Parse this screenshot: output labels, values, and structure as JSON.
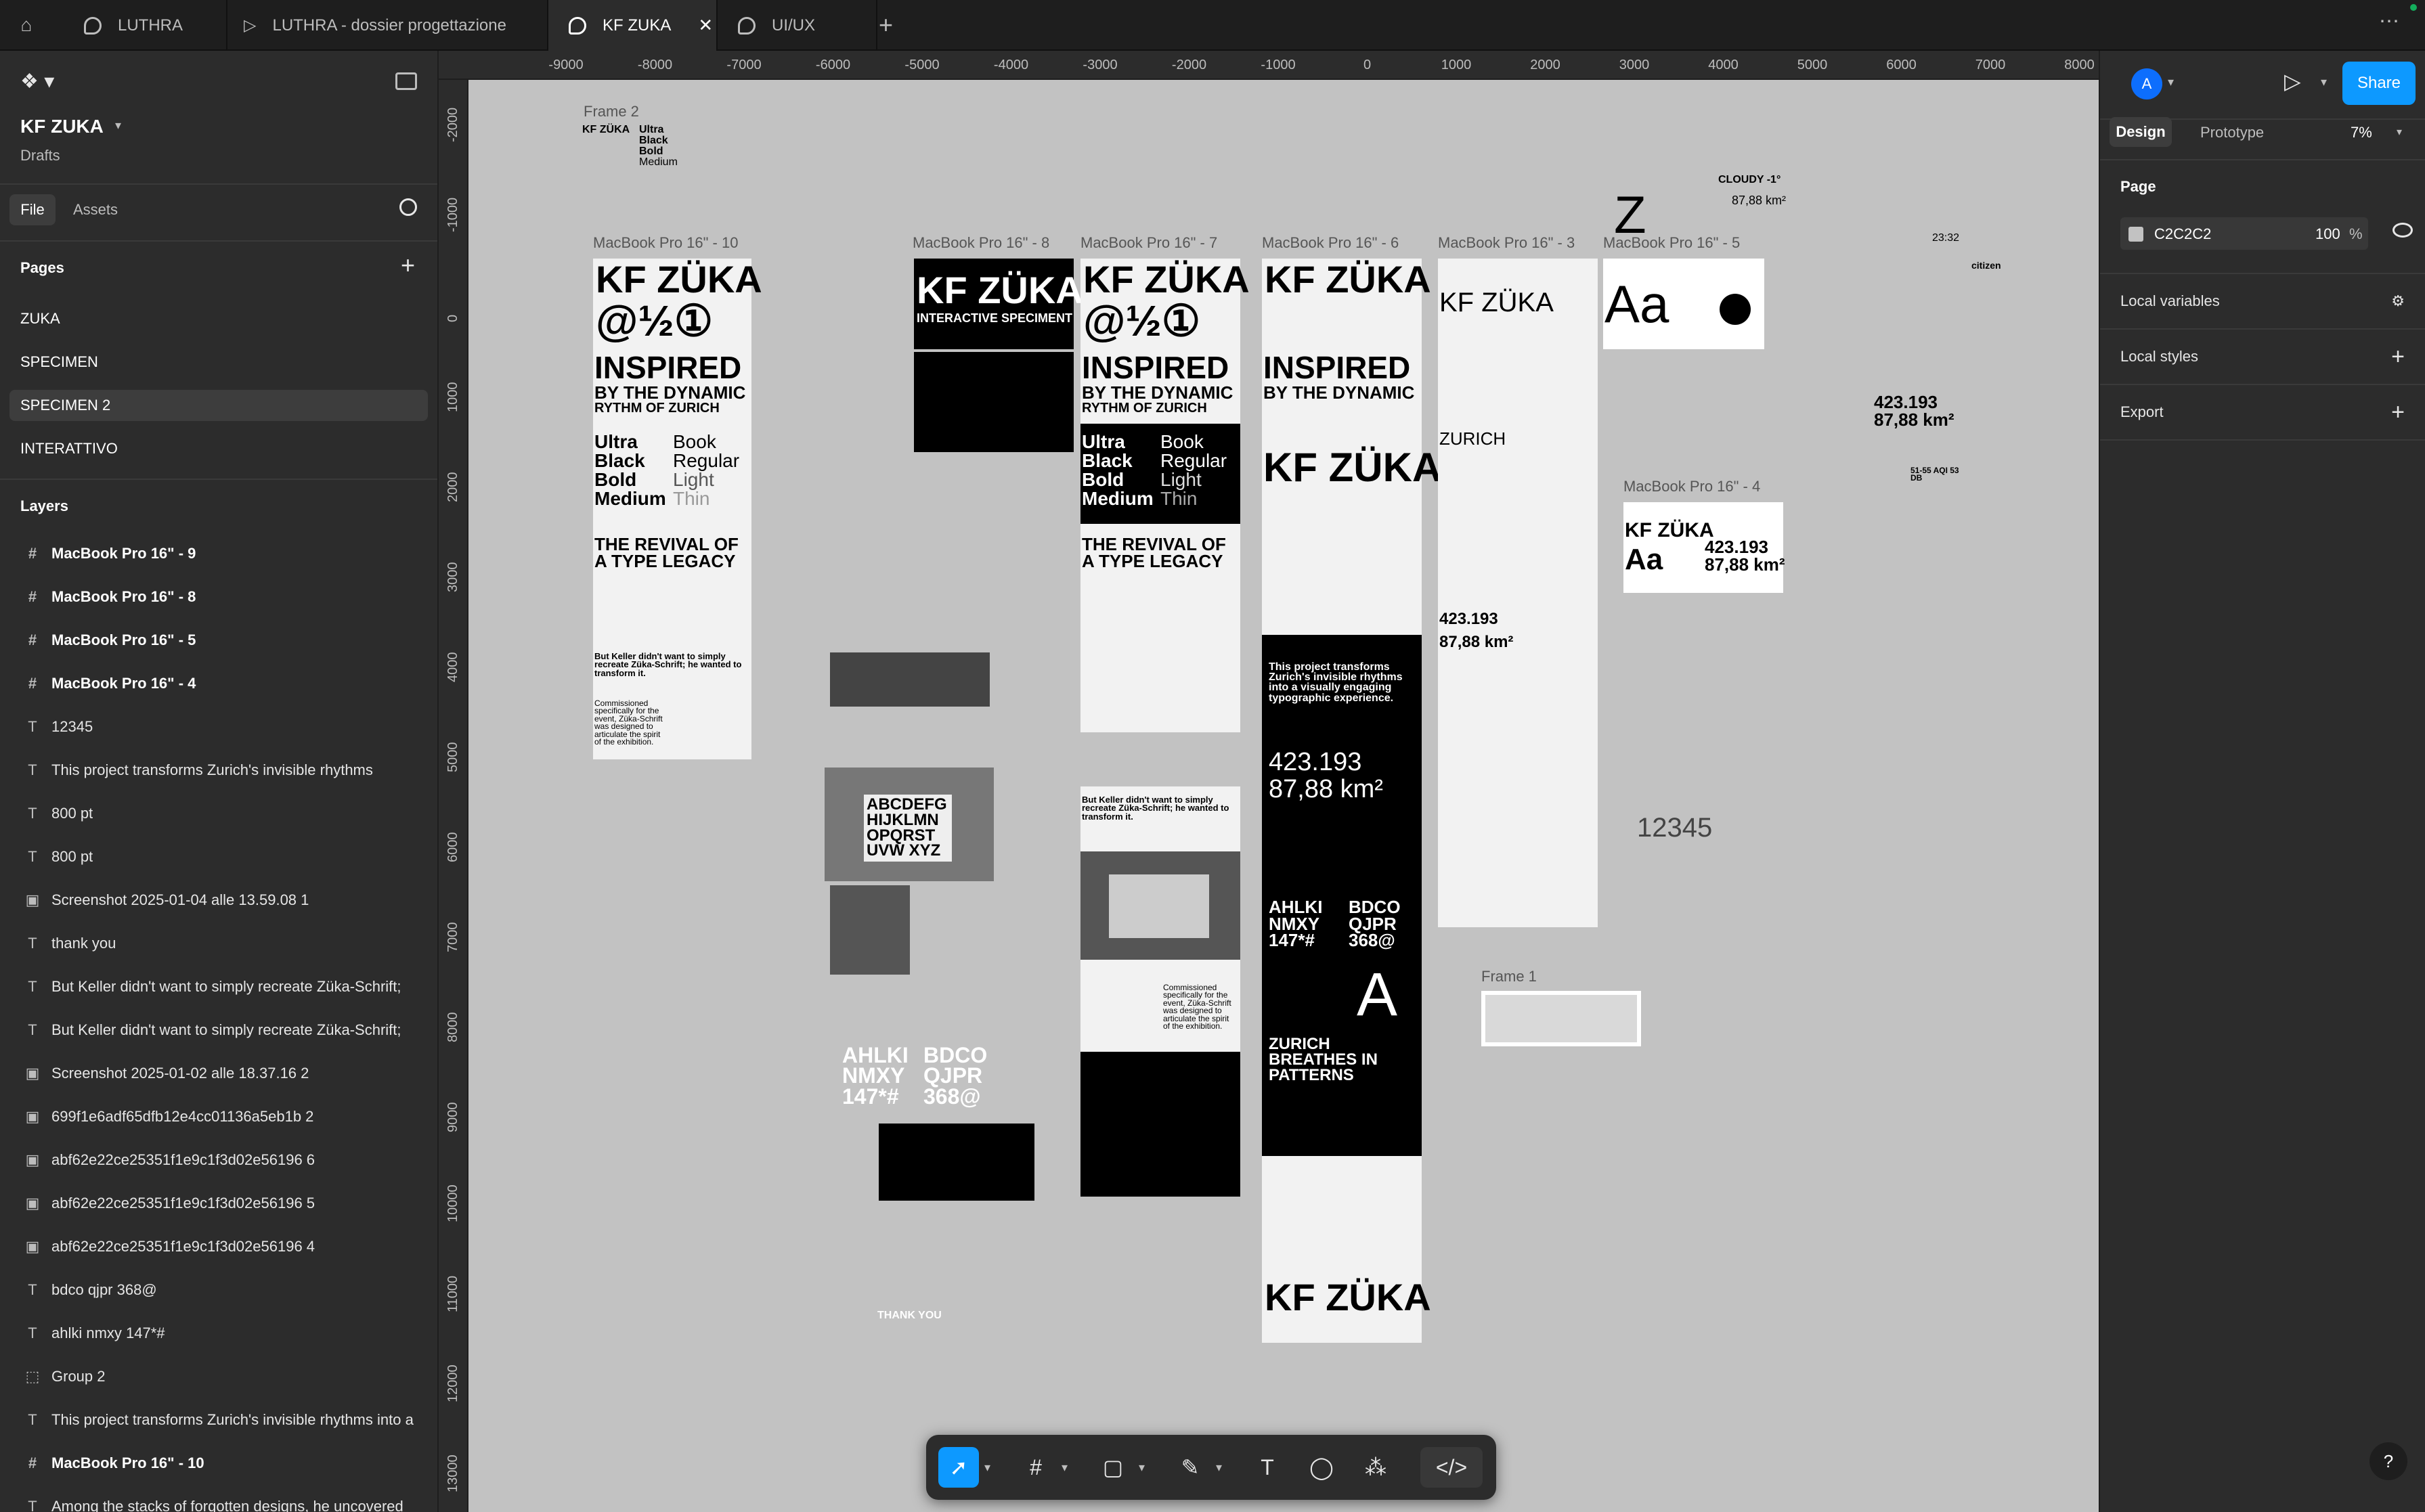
{
  "tabs": [
    {
      "label": "LUTHRA",
      "icon": "figma-file-icon"
    },
    {
      "label": "LUTHRA - dossier progettazione",
      "icon": "slides-icon"
    },
    {
      "label": "KF ZUKA",
      "icon": "figma-file-icon",
      "active": true
    },
    {
      "label": "UI/UX",
      "icon": "figma-file-icon"
    }
  ],
  "file": {
    "name": "KF ZUKA",
    "location": "Drafts"
  },
  "left_tabs": {
    "file": "File",
    "assets": "Assets"
  },
  "pages": {
    "heading": "Pages",
    "items": [
      "ZUKA",
      "SPECIMEN",
      "SPECIMEN 2",
      "INTERATTIVO"
    ],
    "selected": "SPECIMEN 2"
  },
  "layers": {
    "heading": "Layers",
    "items": [
      {
        "icon": "#",
        "name": "MacBook Pro 16\" - 9",
        "bold": true
      },
      {
        "icon": "#",
        "name": "MacBook Pro 16\" - 8",
        "bold": true
      },
      {
        "icon": "#",
        "name": "MacBook Pro 16\" - 5",
        "bold": true
      },
      {
        "icon": "#",
        "name": "MacBook Pro 16\" - 4",
        "bold": true
      },
      {
        "icon": "T",
        "name": "12345"
      },
      {
        "icon": "T",
        "name": "This project transforms Zurich's invisible rhythms"
      },
      {
        "icon": "T",
        "name": "800 pt"
      },
      {
        "icon": "T",
        "name": "800 pt"
      },
      {
        "icon": "▣",
        "name": "Screenshot 2025-01-04 alle 13.59.08 1"
      },
      {
        "icon": "T",
        "name": "thank you"
      },
      {
        "icon": "T",
        "name": "But Keller didn't want to simply recreate Züka-Schrift;"
      },
      {
        "icon": "T",
        "name": "But Keller didn't want to simply recreate Züka-Schrift;"
      },
      {
        "icon": "▣",
        "name": "Screenshot 2025-01-02 alle 18.37.16 2"
      },
      {
        "icon": "▣",
        "name": "699f1e6adf65dfb12e4cc01136a5eb1b 2"
      },
      {
        "icon": "▣",
        "name": "abf62e22ce25351f1e9c1f3d02e56196 6"
      },
      {
        "icon": "▣",
        "name": "abf62e22ce25351f1e9c1f3d02e56196 5"
      },
      {
        "icon": "▣",
        "name": "abf62e22ce25351f1e9c1f3d02e56196 4"
      },
      {
        "icon": "T",
        "name": "bdco qjpr 368@"
      },
      {
        "icon": "T",
        "name": "ahlki nmxy 147*#"
      },
      {
        "icon": "⬚",
        "name": "Group 2"
      },
      {
        "icon": "T",
        "name": "This project transforms Zurich's invisible rhythms into a"
      },
      {
        "icon": "#",
        "name": "MacBook Pro 16\" - 10",
        "bold": true
      },
      {
        "icon": "T",
        "name": "Among the stacks of forgotten designs, he uncovered"
      }
    ]
  },
  "ruler": {
    "top": [
      "-9000",
      "-8000",
      "-7000",
      "-6000",
      "-5000",
      "-4000",
      "-3000",
      "-2000",
      "-1000",
      "0",
      "1000",
      "2000",
      "3000",
      "4000",
      "5000",
      "6000",
      "7000",
      "8000"
    ],
    "left": [
      "-2000",
      "-1000",
      "0",
      "1000",
      "2000",
      "3000",
      "4000",
      "5000",
      "6000",
      "7000",
      "8000",
      "9000",
      "10000",
      "11000",
      "12000",
      "13000"
    ]
  },
  "header_right": {
    "avatar": "A",
    "share": "Share"
  },
  "design_tabs": {
    "design": "Design",
    "prototype": "Prototype",
    "zoom": "7%"
  },
  "page_panel": {
    "heading": "Page",
    "color": "C2C2C2",
    "opacity": "100",
    "percent": "%"
  },
  "sections": [
    "Local variables",
    "Local styles",
    "Export"
  ],
  "frames": {
    "f2": "Frame 2",
    "f10": "MacBook Pro 16\" - 10",
    "f8": "MacBook Pro 16\" - 8",
    "f7": "MacBook Pro 16\" - 7",
    "f6": "MacBook Pro 16\" - 6",
    "f3": "MacBook Pro 16\" - 3",
    "f5": "MacBook Pro 16\" - 5",
    "f4": "MacBook Pro 16\" - 4",
    "f1": "Frame 1"
  },
  "canvas_text": {
    "kfzuka": "KF ZÜKA",
    "glyphs": "@½①",
    "inspired": "INSPIRED",
    "bythe": "BY THE DYNAMIC",
    "rythm": "RYTHM OF ZURICH",
    "revival": "THE REVIVAL OF A TYPE LEGACY",
    "interactive": "INTERACTIVE SPECIMENT",
    "w1": "Ultra",
    "w2": "Black",
    "w3": "Bold",
    "w4": "Medium",
    "w5": "Book",
    "w6": "Regular",
    "w7": "Light",
    "w8": "Thin",
    "keller": "But Keller didn't want to simply recreate Züka-Schrift; he wanted to transform it.",
    "commissioned": "Commissioned specifically for the event, Züka-Schrift was designed to articulate the spirit of the exhibition.",
    "area": "423.193",
    "km": "87,88 km²",
    "cloudy": "CLOUDY -1°",
    "zurich": "ZURICH",
    "zur_breathes": "ZURICH BREATHES IN PATTERNS",
    "ahlki": "AHLKI NMXY 147*#",
    "bdco": "BDCO QJPR 368@",
    "num": "12345",
    "thank": "THANK YOU",
    "project": "This project transforms Zurich's invisible rhythms into a visually engaging typographic experience.",
    "aa": "Aa",
    "time": "23:32",
    "z": "Z",
    "abc": "ABCDEFG HIJKLMN OPQRST UVW XYZ",
    "aqi": "51-55 AQI 53 DB",
    "citizen": "citizen",
    "bigA": "A"
  }
}
